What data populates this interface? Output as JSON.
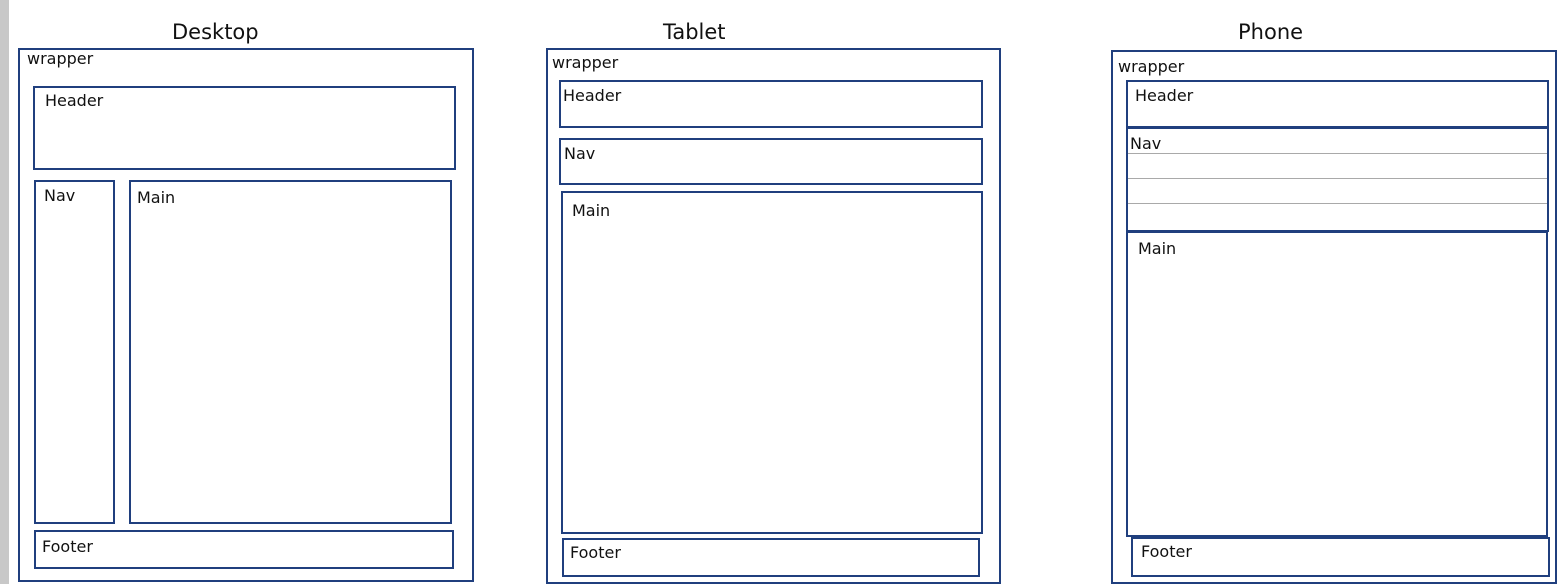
{
  "layouts": {
    "desktop": {
      "title": "Desktop",
      "wrapper": "wrapper",
      "header": "Header",
      "nav": "Nav",
      "main": "Main",
      "footer": "Footer"
    },
    "tablet": {
      "title": "Tablet",
      "wrapper": "wrapper",
      "header": "Header",
      "nav": "Nav",
      "main": "Main",
      "footer": "Footer"
    },
    "phone": {
      "title": "Phone",
      "wrapper": "wrapper",
      "header": "Header",
      "nav": "Nav",
      "main": "Main",
      "footer": "Footer"
    }
  },
  "colors": {
    "border": "#203f7e",
    "frame": "#c8c8c8",
    "background": "#ffffff"
  }
}
